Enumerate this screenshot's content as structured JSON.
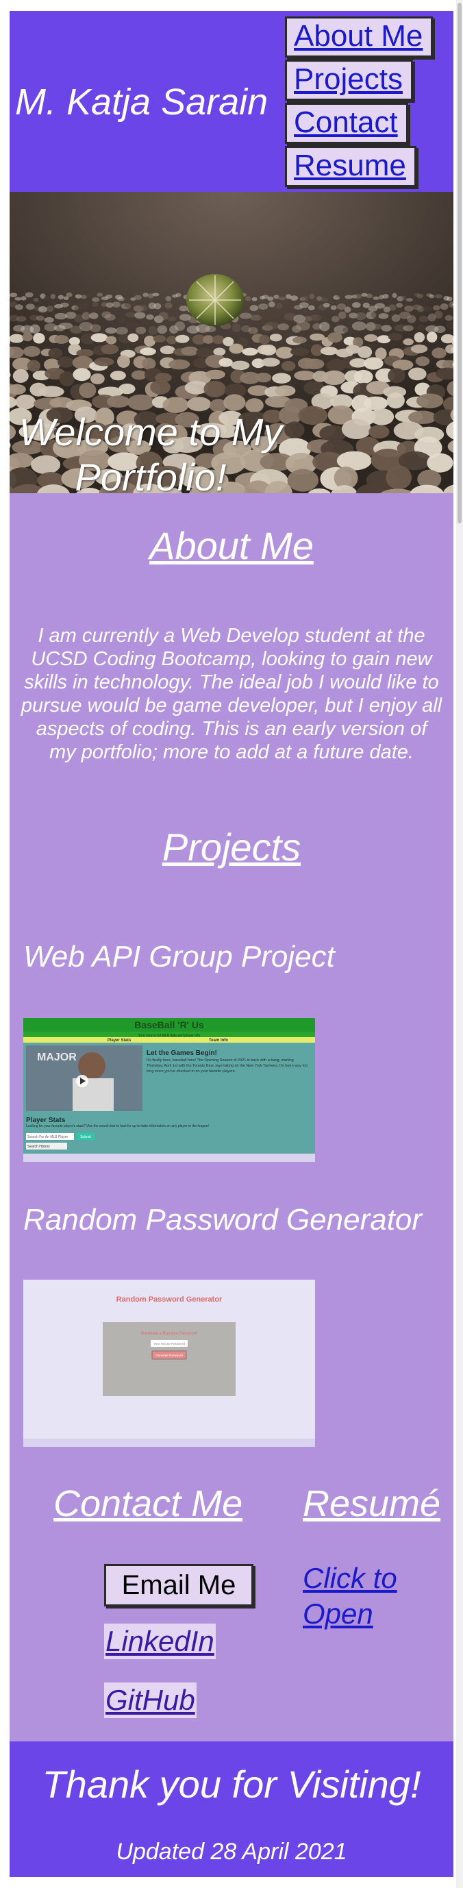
{
  "header": {
    "site_title": "M. Katja Sarain",
    "nav": [
      "About Me",
      "Projects",
      "Contact",
      "Resume"
    ]
  },
  "hero": {
    "welcome": "Welcome to My Portfolio!"
  },
  "about": {
    "heading": "About Me",
    "paragraph": "I am currently a Web Develop student at the UCSD Coding Bootcamp, looking to gain new skills in technology. The ideal job I would like to pursue would be game developer, but I enjoy all aspects of coding. This is an early version of my portfolio; more to add at a future date."
  },
  "projects": {
    "heading": "Projects",
    "items": [
      {
        "title": "Web API Group Project",
        "shot": {
          "app_title": "BaseBall 'R' Us",
          "tagline": "Your source for MLB data and player info",
          "col_left": "Player Stats",
          "col_right": "Team Info",
          "game_heading": "Let the Games Begin!",
          "game_text": "It's finally here, baseball fans! The Opening Season of 2021 is back with a bang, starting Thursday, April 1st with the Toronto Blue Jays taking on the New York Yankees. It's been way too long since you've checked in on your favorite players.",
          "video_logo": "MAJOR",
          "stats_heading": "Player Stats",
          "stats_text": "Looking for your favorite player's stats? Use the search bar to look for up-to-date information on any player in the league!",
          "search_label": "Search For An MLB Player",
          "submit": "Submit",
          "dropdown": "Search History"
        }
      },
      {
        "title": "Random Password Generator",
        "shot": {
          "app_title": "Random Password Generator",
          "card_title": "Generate a Random Password",
          "field_placeholder": "Your Secure Password",
          "button": "Generate Password"
        }
      }
    ]
  },
  "contact": {
    "heading": "Contact Me",
    "email_button": "Email Me",
    "links": [
      "LinkedIn",
      "GitHub"
    ]
  },
  "resume": {
    "heading": "Resumé",
    "link": "Click to Open"
  },
  "footer": {
    "thanks": "Thank you for Visiting!",
    "updated": "Updated 28 April 2021"
  },
  "colors": {
    "header": "#6b45e8",
    "main": "#b392dd",
    "chip": "#e4d6f3",
    "link": "#1a1ac8"
  }
}
